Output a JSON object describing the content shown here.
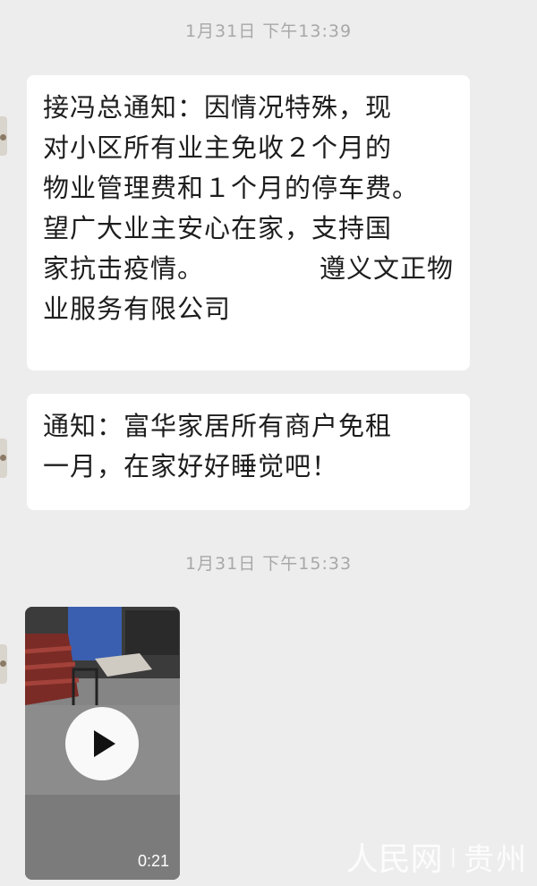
{
  "chat": {
    "timestamps": [
      "1月31日 下午13:39",
      "1月31日 下午15:33"
    ],
    "messages": [
      {
        "lines": [
          "接冯总通知：因情况特殊，现",
          "对小区所有业主免收２个月的",
          "物业管理费和１个月的停车费。",
          "望广大业主安心在家，支持国"
        ],
        "sign_left": "家抗击疫情。",
        "sign_right": "遵义文正物",
        "last_line": "业服务有限公司"
      },
      {
        "lines": [
          "通知：富华家居所有商户免租",
          "一月，在家好好睡觉吧！"
        ]
      }
    ],
    "video": {
      "duration": "0:21",
      "icon": "play-icon"
    }
  },
  "watermark": {
    "logo": "人民网",
    "separator": "|",
    "region": "贵州",
    "color": "#ffffff"
  }
}
